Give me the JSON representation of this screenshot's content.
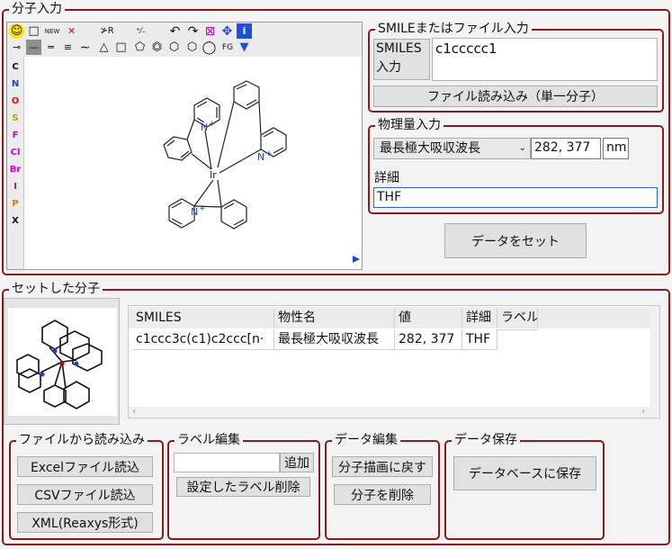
{
  "input_group": {
    "title": "分子入力"
  },
  "editor": {
    "toolbar_row1": [
      "☺",
      "□",
      "NEW",
      "✕",
      "≯R",
      "⁺⁄₋",
      "↶",
      "↷",
      "⊠",
      "✥",
      "i"
    ],
    "toolbar_row2": [
      "⊸",
      "—",
      "═",
      "≡",
      "∼",
      "△",
      "□",
      "⬠",
      "⏣",
      "⬡",
      "⬡",
      "◯",
      "FG",
      "▼"
    ],
    "atoms": [
      {
        "label": "C",
        "color": "#111111"
      },
      {
        "label": "N",
        "color": "#1f3fd6"
      },
      {
        "label": "O",
        "color": "#e01010"
      },
      {
        "label": "S",
        "color": "#b8a000"
      },
      {
        "label": "F",
        "color": "#cc00cc"
      },
      {
        "label": "Cl",
        "color": "#cc00cc"
      },
      {
        "label": "Br",
        "color": "#cc00cc"
      },
      {
        "label": "I",
        "color": "#cc00cc"
      },
      {
        "label": "P",
        "color": "#d08000"
      },
      {
        "label": "X",
        "color": "#111111"
      }
    ],
    "atom_labels": {
      "ir": "Ir",
      "n1": "N",
      "n2": "N",
      "n3": "N",
      "plus": "+"
    }
  },
  "smiles_group": {
    "title": "SMILEまたはファイル入力",
    "label_line1": "SMILES",
    "label_line2": "入力",
    "value": "c1ccccc1",
    "file_button": "ファイル読み込み（単一分子）"
  },
  "property_group": {
    "title": "物理量入力",
    "property_select": "最長極大吸収波長",
    "value": "282, 377",
    "unit": "nm",
    "detail_label": "詳細",
    "detail_value": "THF"
  },
  "set_data_button": "データをセット",
  "set_molecules_group": {
    "title": "セットした分子",
    "columns": [
      "SMILES",
      "物性名",
      "値",
      "詳細",
      "ラベル"
    ],
    "rows": [
      {
        "smiles": "c1ccc3c(c1)c2ccc[n·",
        "property": "最長極大吸収波長",
        "value": "282, 377",
        "detail": "THF",
        "label": ""
      }
    ],
    "scroll_left": "‹",
    "scroll_right": "›"
  },
  "file_read_group": {
    "title": "ファイルから読み込み",
    "excel_button": "Excelファイル読込",
    "csv_button": "CSVファイル読込",
    "xml_button": "XML(Reaxys形式)"
  },
  "label_edit_group": {
    "title": "ラベル編集",
    "label_input": "",
    "add_button": "追加",
    "delete_button": "設定したラベル削除"
  },
  "data_edit_group": {
    "title": "データ編集",
    "back_button": "分子描画に戻す",
    "delete_button": "分子を削除"
  },
  "data_save_group": {
    "title": "データ保存",
    "save_button": "データベースに保存"
  }
}
